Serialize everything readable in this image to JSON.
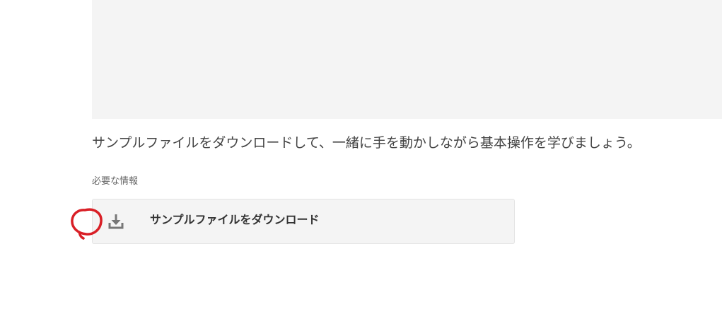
{
  "intro": {
    "text": "サンプルファイルをダウンロードして、一緒に手を動かしながら基本操作を学びましょう。"
  },
  "resources": {
    "section_label": "必要な情報",
    "download_label": "サンプルファイルをダウンロード",
    "icon": "download-icon"
  },
  "annotation": {
    "shape": "hand-drawn-circle",
    "color": "#d91f26"
  }
}
